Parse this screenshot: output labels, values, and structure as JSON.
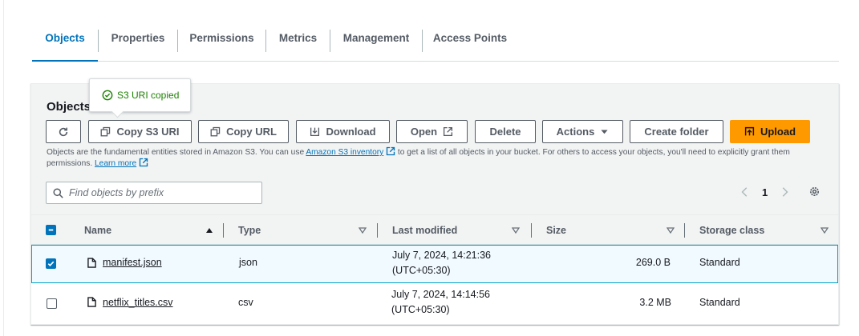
{
  "tabs": [
    {
      "label": "Objects",
      "active": true
    },
    {
      "label": "Properties"
    },
    {
      "label": "Permissions"
    },
    {
      "label": "Metrics"
    },
    {
      "label": "Management"
    },
    {
      "label": "Access Points"
    }
  ],
  "panel": {
    "title": "Objects",
    "popover": "S3 URI copied",
    "buttons": {
      "refresh": "",
      "copy_s3_uri": "Copy S3 URI",
      "copy_url": "Copy URL",
      "download": "Download",
      "open": "Open",
      "delete": "Delete",
      "actions": "Actions",
      "create_folder": "Create folder",
      "upload": "Upload"
    },
    "description": {
      "part1": "Objects are the fundamental entities stored in Amazon S3. You can use ",
      "link1": "Amazon S3 inventory",
      "part2": " to get a list of all objects in your bucket. For others to access your objects, you'll need to explicitly grant them permissions. ",
      "link2": "Learn more"
    },
    "search_placeholder": "Find objects by prefix",
    "page_number": "1"
  },
  "table": {
    "headers": {
      "name": "Name",
      "type": "Type",
      "last_modified": "Last modified",
      "size": "Size",
      "storage_class": "Storage class"
    },
    "rows": [
      {
        "name": "manifest.json",
        "type": "json",
        "modified_line1": "July 7, 2024, 14:21:36",
        "modified_line2": "(UTC+05:30)",
        "size": "269.0 B",
        "storage_class": "Standard",
        "selected": true
      },
      {
        "name": "netflix_titles.csv",
        "type": "csv",
        "modified_line1": "July 7, 2024, 14:14:56",
        "modified_line2": "(UTC+05:30)",
        "size": "3.2 MB",
        "storage_class": "Standard",
        "selected": false
      }
    ]
  },
  "colors": {
    "accent": "#0073bb",
    "upload": "#ff9900",
    "success": "#1d8102",
    "selected_row_bg": "#f1faff"
  }
}
